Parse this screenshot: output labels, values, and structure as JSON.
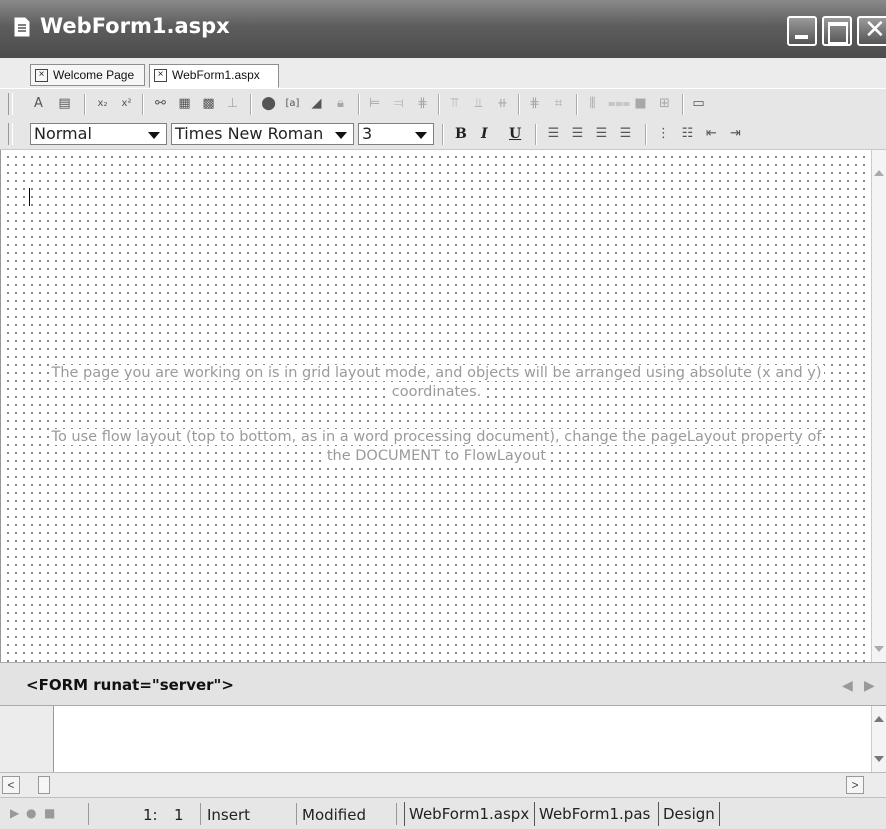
{
  "window": {
    "title": "WebForm1.aspx"
  },
  "tabs": [
    {
      "label": "Welcome Page"
    },
    {
      "label": "WebForm1.aspx"
    }
  ],
  "format_toolbar": {
    "block_format": "Normal",
    "font_name": "Times New Roman",
    "font_size": "3",
    "bold_label": "B",
    "italic_label": "I",
    "underline_label": "U"
  },
  "design_surface": {
    "message_line1": "The page you are working on is in grid layout mode, and objects will be arranged using absolute (x and y)",
    "message_line2": "coordinates.",
    "message_line3": "To use flow layout (top to bottom, as in a word processing document), change the pageLayout property of",
    "message_line4": "the DOCUMENT to FlowLayout"
  },
  "tag_path": {
    "text": "<FORM runat=\"server\">"
  },
  "status_bar": {
    "line": "1:",
    "col": "1",
    "mode": "Insert",
    "state": "Modified"
  },
  "view_tabs": [
    {
      "label": "WebForm1.aspx"
    },
    {
      "label": "WebForm1.pas"
    },
    {
      "label": "Design"
    }
  ],
  "colors": {
    "title_bar": "#5d5d5d",
    "background": "#ececec"
  }
}
